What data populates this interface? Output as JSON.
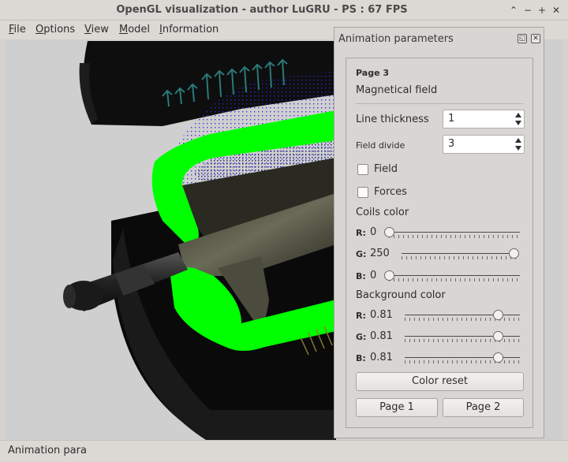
{
  "window": {
    "title": "OpenGL visualization - author LuGRU - PS : 67 FPS"
  },
  "menu": {
    "items": [
      {
        "first": "F",
        "rest": "ile"
      },
      {
        "first": "O",
        "rest": "ptions"
      },
      {
        "first": "V",
        "rest": "iew"
      },
      {
        "first": "M",
        "rest": "odel"
      },
      {
        "first": "I",
        "rest": "nformation"
      }
    ]
  },
  "statusbar": {
    "text": "Animation para"
  },
  "panel": {
    "title": "Animation parameters",
    "page_label": "Page 3",
    "section_title": "Magnetical field",
    "line_thickness": {
      "label": "Line thickness",
      "value": "1"
    },
    "field_divide": {
      "label": "Field divide",
      "value": "3"
    },
    "field_checkbox": {
      "label": "Field",
      "checked": false
    },
    "forces_checkbox": {
      "label": "Forces",
      "checked": false
    },
    "coils_color": {
      "title": "Coils color",
      "r": {
        "label": "R:",
        "value": "0",
        "level": 0.0
      },
      "g": {
        "label": "G:",
        "value": "250",
        "level": 0.98
      },
      "b": {
        "label": "B:",
        "value": "0",
        "level": 0.0
      }
    },
    "background_color": {
      "title": "Background color",
      "r": {
        "label": "R:",
        "value": "0.81(",
        "level": 0.81
      },
      "g": {
        "label": "G:",
        "value": "0.81(",
        "level": 0.81
      },
      "b": {
        "label": "B:",
        "value": "0.81(",
        "level": 0.81
      }
    },
    "color_reset_label": "Color reset",
    "page1_label": "Page 1",
    "page2_label": "Page 2"
  },
  "colors": {
    "coil": "#00ff00",
    "background": "#cfcfcf",
    "field_lines": "#1a1a8c",
    "arrows": "#2a7a7a"
  }
}
